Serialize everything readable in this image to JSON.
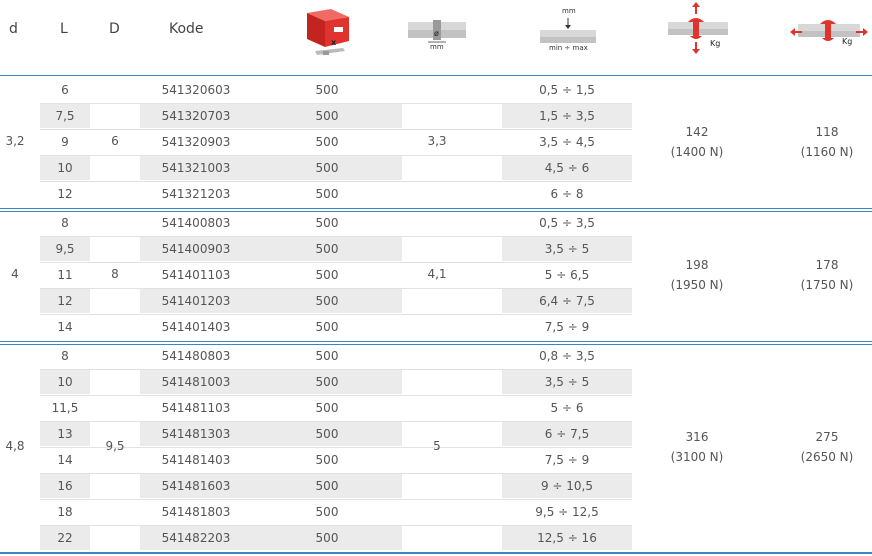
{
  "header": {
    "d": "d",
    "L": "L",
    "D": "D",
    "kode": "Kode",
    "box_x": "x",
    "dia_label": "ø",
    "dia_unit": "mm",
    "grip_unit": "mm",
    "grip_range": "min ÷ max",
    "kg1": "Kg",
    "kg2": "Kg"
  },
  "colors": {
    "rule": "#3d86c6",
    "stripe": "#ebebeb",
    "icon_red": "#e0332d",
    "text": "#555555"
  },
  "groups": [
    {
      "d": "3,2",
      "D": "6",
      "hole": "3,3",
      "tensile": "142",
      "tensile_n": "(1400 N)",
      "shear": "118",
      "shear_n": "(1160 N)",
      "rows": [
        {
          "L": "6",
          "kode": "541320603",
          "qty": "500",
          "grip": "0,5 ÷ 1,5"
        },
        {
          "L": "7,5",
          "kode": "541320703",
          "qty": "500",
          "grip": "1,5 ÷ 3,5"
        },
        {
          "L": "9",
          "kode": "541320903",
          "qty": "500",
          "grip": "3,5 ÷ 4,5"
        },
        {
          "L": "10",
          "kode": "541321003",
          "qty": "500",
          "grip": "4,5 ÷ 6"
        },
        {
          "L": "12",
          "kode": "541321203",
          "qty": "500",
          "grip": "6 ÷ 8"
        }
      ]
    },
    {
      "d": "4",
      "D": "8",
      "hole": "4,1",
      "tensile": "198",
      "tensile_n": "(1950 N)",
      "shear": "178",
      "shear_n": "(1750 N)",
      "rows": [
        {
          "L": "8",
          "kode": "541400803",
          "qty": "500",
          "grip": "0,5 ÷ 3,5"
        },
        {
          "L": "9,5",
          "kode": "541400903",
          "qty": "500",
          "grip": "3,5 ÷ 5"
        },
        {
          "L": "11",
          "kode": "541401103",
          "qty": "500",
          "grip": "5 ÷ 6,5"
        },
        {
          "L": "12",
          "kode": "541401203",
          "qty": "500",
          "grip": "6,4 ÷ 7,5"
        },
        {
          "L": "14",
          "kode": "541401403",
          "qty": "500",
          "grip": "7,5 ÷ 9"
        }
      ]
    },
    {
      "d": "4,8",
      "D": "9,5",
      "hole": "5",
      "tensile": "316",
      "tensile_n": "(3100 N)",
      "shear": "275",
      "shear_n": "(2650 N)",
      "rows": [
        {
          "L": "8",
          "kode": "541480803",
          "qty": "500",
          "grip": "0,8 ÷ 3,5"
        },
        {
          "L": "10",
          "kode": "541481003",
          "qty": "500",
          "grip": "3,5 ÷ 5"
        },
        {
          "L": "11,5",
          "kode": "541481103",
          "qty": "500",
          "grip": "5 ÷ 6"
        },
        {
          "L": "13",
          "kode": "541481303",
          "qty": "500",
          "grip": "6 ÷ 7,5"
        },
        {
          "L": "14",
          "kode": "541481403",
          "qty": "500",
          "grip": "7,5 ÷ 9"
        },
        {
          "L": "16",
          "kode": "541481603",
          "qty": "500",
          "grip": "9 ÷ 10,5"
        },
        {
          "L": "18",
          "kode": "541481803",
          "qty": "500",
          "grip": "9,5 ÷ 12,5"
        },
        {
          "L": "22",
          "kode": "541482203",
          "qty": "500",
          "grip": "12,5 ÷ 16"
        }
      ]
    }
  ]
}
